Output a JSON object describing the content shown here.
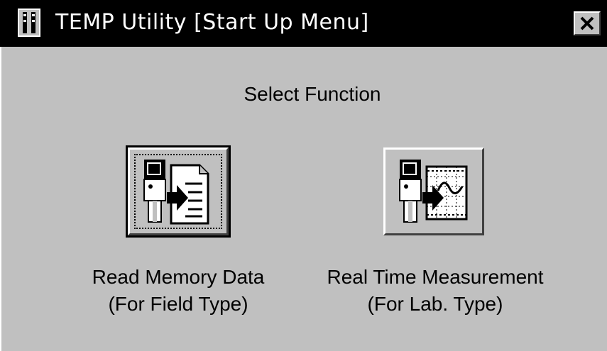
{
  "window": {
    "title": "TEMP Utility [Start Up Menu]",
    "title_icon": "thermometer-icon",
    "close_label": "X"
  },
  "main": {
    "heading": "Select Function",
    "functions": [
      {
        "icon": "meter-to-document-icon",
        "line1": "Read Memory Data",
        "line2": "(For Field Type)",
        "default": true
      },
      {
        "icon": "meter-to-graph-icon",
        "line1": "Real Time Measurement",
        "line2": "(For Lab. Type)",
        "default": false
      }
    ]
  },
  "colors": {
    "face": "#c0c0c0",
    "titlebar": "#000000",
    "title_text": "#ffffff"
  }
}
